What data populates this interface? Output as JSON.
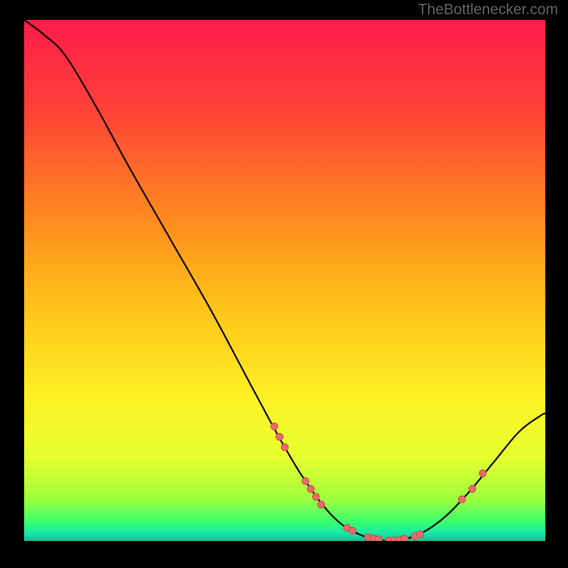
{
  "watermark": "TheBottlenecker.com",
  "colors": {
    "gradient_stops": [
      {
        "offset": 0.0,
        "color": "#ff1b4b"
      },
      {
        "offset": 0.18,
        "color": "#ff4338"
      },
      {
        "offset": 0.38,
        "color": "#ff8a1f"
      },
      {
        "offset": 0.55,
        "color": "#ffc21a"
      },
      {
        "offset": 0.72,
        "color": "#fff024"
      },
      {
        "offset": 0.84,
        "color": "#e6ff2f"
      },
      {
        "offset": 0.92,
        "color": "#9dff3d"
      },
      {
        "offset": 0.965,
        "color": "#34ff72"
      },
      {
        "offset": 0.985,
        "color": "#18e8a8"
      },
      {
        "offset": 1.0,
        "color": "#1fb890"
      }
    ],
    "dot_fill": "#e96a6a",
    "dot_stroke": "#c94d4d",
    "curve_stroke": "#000000"
  },
  "chart_data": {
    "type": "line",
    "title": "",
    "xlabel": "",
    "ylabel": "",
    "xlim": [
      0,
      100
    ],
    "ylim": [
      0,
      100
    ],
    "grid": false,
    "curve": [
      {
        "x": 0,
        "y": 100
      },
      {
        "x": 4,
        "y": 97
      },
      {
        "x": 8,
        "y": 93
      },
      {
        "x": 14,
        "y": 83
      },
      {
        "x": 20,
        "y": 72
      },
      {
        "x": 28,
        "y": 58
      },
      {
        "x": 36,
        "y": 44
      },
      {
        "x": 44,
        "y": 29
      },
      {
        "x": 50,
        "y": 18
      },
      {
        "x": 55,
        "y": 10
      },
      {
        "x": 60,
        "y": 4
      },
      {
        "x": 65,
        "y": 1
      },
      {
        "x": 70,
        "y": 0
      },
      {
        "x": 75,
        "y": 1
      },
      {
        "x": 80,
        "y": 4
      },
      {
        "x": 85,
        "y": 9
      },
      {
        "x": 90,
        "y": 15
      },
      {
        "x": 95,
        "y": 21
      },
      {
        "x": 99,
        "y": 24
      },
      {
        "x": 100,
        "y": 24.5
      }
    ],
    "dots": [
      {
        "x": 48,
        "y": 22
      },
      {
        "x": 49,
        "y": 20
      },
      {
        "x": 50,
        "y": 18
      },
      {
        "x": 54,
        "y": 11.5
      },
      {
        "x": 55,
        "y": 10
      },
      {
        "x": 56,
        "y": 8.5
      },
      {
        "x": 57,
        "y": 7
      },
      {
        "x": 62,
        "y": 2.5
      },
      {
        "x": 63,
        "y": 2
      },
      {
        "x": 66,
        "y": 0.7
      },
      {
        "x": 67,
        "y": 0.5
      },
      {
        "x": 68,
        "y": 0.3
      },
      {
        "x": 70,
        "y": 0.1
      },
      {
        "x": 71,
        "y": 0.1
      },
      {
        "x": 72,
        "y": 0.2
      },
      {
        "x": 73,
        "y": 0.4
      },
      {
        "x": 75,
        "y": 0.9
      },
      {
        "x": 76,
        "y": 1.3
      },
      {
        "x": 84,
        "y": 8
      },
      {
        "x": 86,
        "y": 10
      },
      {
        "x": 88,
        "y": 13
      }
    ],
    "dot_radius": 5
  }
}
